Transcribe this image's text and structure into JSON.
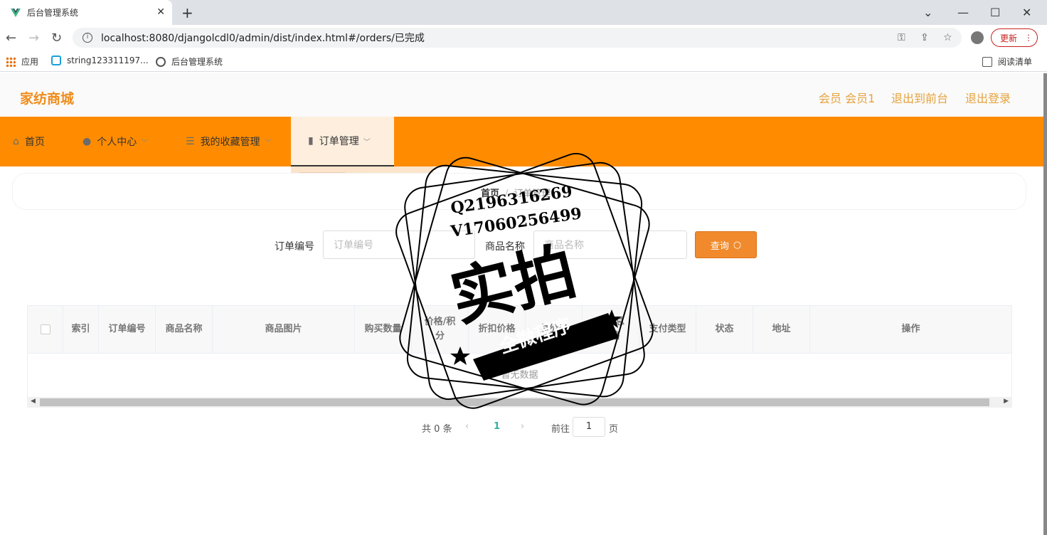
{
  "browser": {
    "tab_title": "后台管理系统",
    "url": "localhost:8080/djangolcdl0/admin/dist/index.html#/orders/已完成",
    "update_label": "更新",
    "bookmarks": [
      "应用",
      "string123311197...",
      "后台管理系统"
    ],
    "reading_list": "阅读清单"
  },
  "header": {
    "brand": "家纺商城",
    "member": "会员 会员1",
    "back_front": "退出到前台",
    "logout": "退出登录"
  },
  "nav": {
    "items": [
      {
        "label": "首页",
        "icon": "home-icon"
      },
      {
        "label": "个人中心",
        "icon": "user-icon"
      },
      {
        "label": "我的收藏管理",
        "icon": "list-icon"
      },
      {
        "label": "订单管理",
        "icon": "book-icon"
      }
    ]
  },
  "breadcrumb": {
    "home": "首页",
    "sep": "/",
    "current": "订单管理"
  },
  "search": {
    "order_label": "订单编号",
    "order_placeholder": "订单编号",
    "product_label": "商品名称",
    "product_placeholder": "商品名称",
    "query_label": "查询"
  },
  "table": {
    "columns": [
      "索引",
      "订单编号",
      "商品名称",
      "商品图片",
      "购买数量",
      "价格/积分",
      "折扣价格",
      "总价格",
      "折扣总价格",
      "支付类型",
      "状态",
      "地址",
      "操作"
    ],
    "empty_text": "暂无数据"
  },
  "pagination": {
    "total": "共 0 条",
    "current_page": "1",
    "goto_label": "前往",
    "goto_value": "1",
    "page_suffix": "页"
  },
  "watermark": {
    "line1": "Q2196316269",
    "line2": "V17060256499",
    "big": "实拍",
    "banner": "全微程序"
  },
  "colors": {
    "nav_bg": "#ff8c00",
    "brand": "#f08c1a",
    "query_button": "#f08a2c"
  }
}
